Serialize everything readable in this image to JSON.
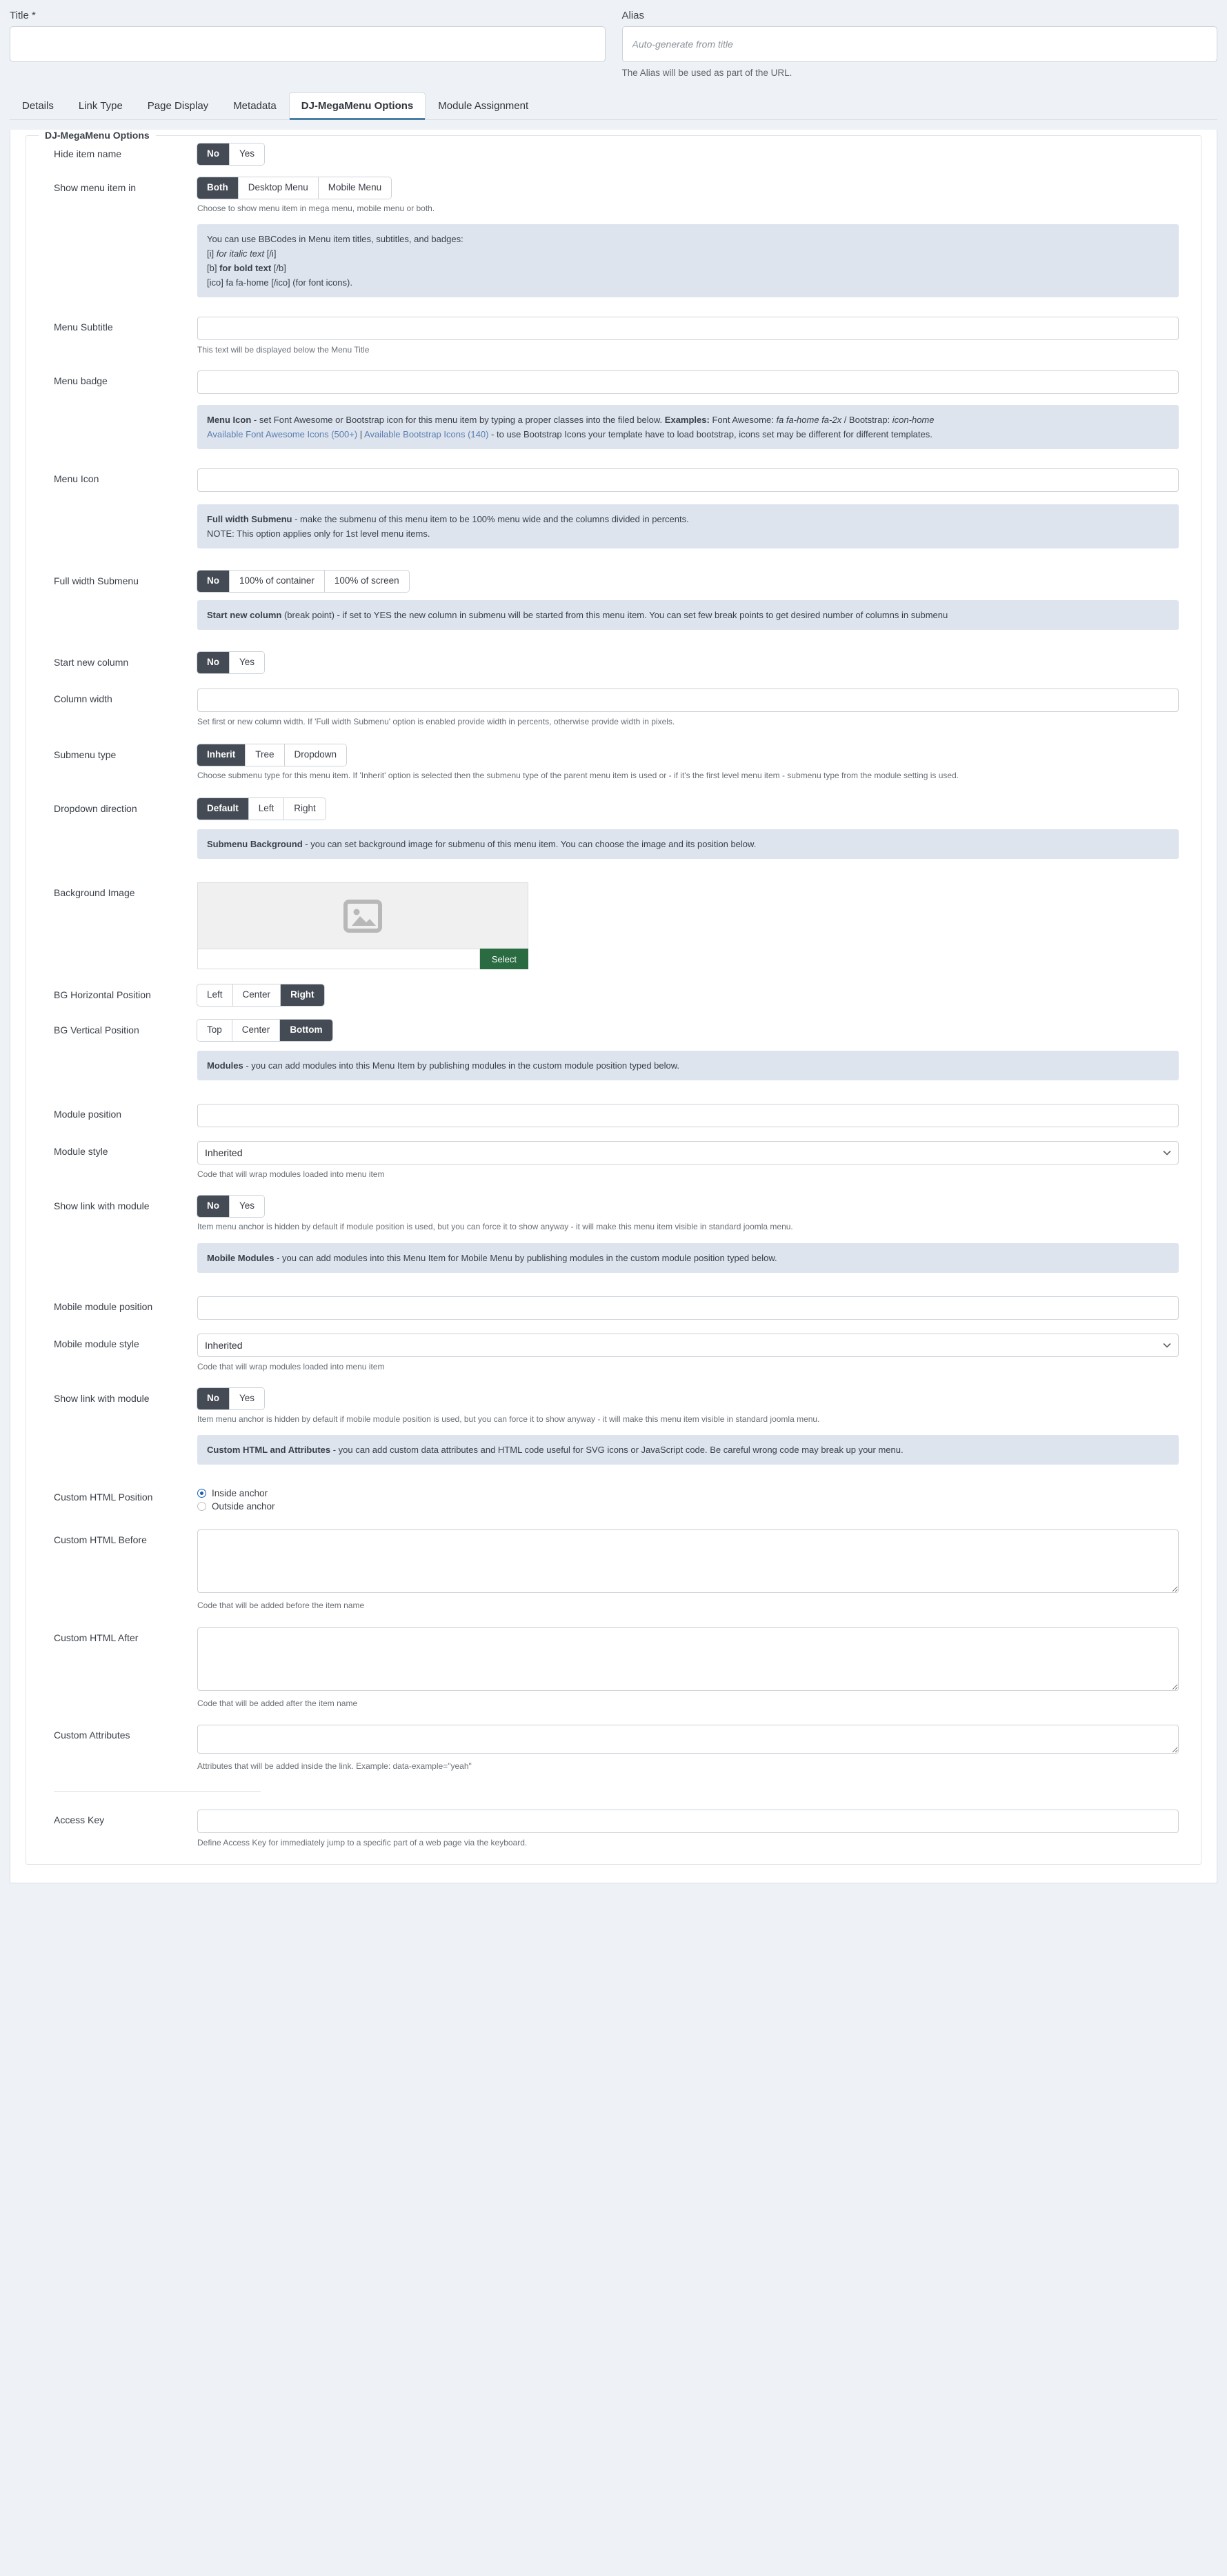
{
  "header": {
    "title_label": "Title *",
    "title_value": "",
    "alias_label": "Alias",
    "alias_placeholder": "Auto-generate from title",
    "alias_help": "The Alias will be used as part of the URL."
  },
  "tabs": [
    {
      "label": "Details",
      "active": false
    },
    {
      "label": "Link Type",
      "active": false
    },
    {
      "label": "Page Display",
      "active": false
    },
    {
      "label": "Metadata",
      "active": false
    },
    {
      "label": "DJ-MegaMenu Options",
      "active": true
    },
    {
      "label": "Module Assignment",
      "active": false
    }
  ],
  "fieldset_legend": "DJ-MegaMenu Options",
  "fields": {
    "hide_item_name": {
      "label": "Hide item name",
      "options": [
        "No",
        "Yes"
      ],
      "selected": "No"
    },
    "show_menu_item_in": {
      "label": "Show menu item in",
      "options": [
        "Both",
        "Desktop Menu",
        "Mobile Menu"
      ],
      "selected": "Both",
      "help": "Choose to show menu item in mega menu, mobile menu or both."
    },
    "bbcode_note": {
      "line1": "You can use BBCodes in Menu item titles, subtitles, and badges:",
      "line2_pre": "[i] ",
      "line2_em": "for italic text",
      "line2_post": " [/i]",
      "line3_pre": "[b] ",
      "line3_b": "for bold text",
      "line3_post": " [/b]",
      "line4": "[ico] fa fa-home [/ico] (for font icons)."
    },
    "menu_subtitle": {
      "label": "Menu Subtitle",
      "value": "",
      "help": "This text will be displayed below the Menu Title"
    },
    "menu_badge": {
      "label": "Menu badge",
      "value": ""
    },
    "menu_icon_note": {
      "bold": "Menu Icon",
      "text1": " - set Font Awesome or Bootstrap icon for this menu item by typing a proper classes into the filed below. ",
      "bold2": "Examples:",
      "text2": " Font Awesome: ",
      "em1": "fa fa-home fa-2x",
      "text3": " / Bootstrap: ",
      "em2": "icon-home",
      "link1": "Available Font Awesome Icons (500+)",
      "sep": " | ",
      "link2": "Available Bootstrap Icons (140)",
      "text4": " - to use Bootstrap Icons your template have to load bootstrap, icons set may be different for different templates."
    },
    "menu_icon": {
      "label": "Menu Icon",
      "value": ""
    },
    "full_width_note": {
      "bold": "Full width Submenu",
      "text": " - make the submenu of this menu item to be 100% menu wide and the columns divided in percents.",
      "line2": "NOTE: This option applies only for 1st level menu items."
    },
    "full_width_submenu": {
      "label": "Full width Submenu",
      "options": [
        "No",
        "100% of container",
        "100% of screen"
      ],
      "selected": "No"
    },
    "start_new_column_note": {
      "bold": "Start new column",
      "text": " (break point) - if set to YES the new column in submenu will be started from this menu item. You can set few break points to get desired number of columns in submenu"
    },
    "start_new_column": {
      "label": "Start new column",
      "options": [
        "No",
        "Yes"
      ],
      "selected": "No"
    },
    "column_width": {
      "label": "Column width",
      "value": "",
      "help": "Set first or new column width. If 'Full width Submenu' option is enabled provide width in percents, otherwise provide width in pixels."
    },
    "submenu_type": {
      "label": "Submenu type",
      "options": [
        "Inherit",
        "Tree",
        "Dropdown"
      ],
      "selected": "Inherit",
      "help": "Choose submenu type for this menu item. If 'Inherit' option is selected then the submenu type of the parent menu item is used or - if it's the first level menu item - submenu type from the module setting is used."
    },
    "dropdown_direction": {
      "label": "Dropdown direction",
      "options": [
        "Default",
        "Left",
        "Right"
      ],
      "selected": "Default"
    },
    "submenu_bg_note": {
      "bold": "Submenu Background",
      "text": " - you can set background image for submenu of this menu item. You can choose the image and its position below."
    },
    "background_image": {
      "label": "Background Image",
      "value": "",
      "select_button": "Select",
      "preview_icon": "image-placeholder-icon"
    },
    "bg_horizontal_position": {
      "label": "BG Horizontal Position",
      "options": [
        "Left",
        "Center",
        "Right"
      ],
      "selected": "Right"
    },
    "bg_vertical_position": {
      "label": "BG Vertical Position",
      "options": [
        "Top",
        "Center",
        "Bottom"
      ],
      "selected": "Bottom"
    },
    "modules_note": {
      "bold": "Modules",
      "text": " - you can add modules into this Menu Item by publishing modules in the custom module position typed below."
    },
    "module_position": {
      "label": "Module position",
      "value": ""
    },
    "module_style": {
      "label": "Module style",
      "value": "Inherited",
      "help": "Code that will wrap modules loaded into menu item"
    },
    "show_link_with_module": {
      "label": "Show link with module",
      "options": [
        "No",
        "Yes"
      ],
      "selected": "No",
      "help": "Item menu anchor is hidden by default if module position is used, but you can force it to show anyway - it will make this menu item visible in standard joomla menu."
    },
    "mobile_modules_note": {
      "bold": "Mobile Modules",
      "text": " - you can add modules into this Menu Item for Mobile Menu by publishing modules in the custom module position typed below."
    },
    "mobile_module_position": {
      "label": "Mobile module position",
      "value": ""
    },
    "mobile_module_style": {
      "label": "Mobile module style",
      "value": "Inherited",
      "help": "Code that will wrap modules loaded into menu item"
    },
    "show_link_with_module_mobile": {
      "label": "Show link with module",
      "options": [
        "No",
        "Yes"
      ],
      "selected": "No",
      "help": "Item menu anchor is hidden by default if mobile module position is used, but you can force it to show anyway - it will make this menu item visible in standard joomla menu."
    },
    "custom_html_note": {
      "bold": "Custom HTML and Attributes",
      "text": " - you can add custom data attributes and HTML code useful for SVG icons or JavaScript code. Be careful wrong code may break up your menu."
    },
    "custom_html_position": {
      "label": "Custom HTML Position",
      "options": [
        "Inside anchor",
        "Outside anchor"
      ],
      "selected": "Inside anchor"
    },
    "custom_html_before": {
      "label": "Custom HTML Before",
      "value": "",
      "help": "Code that will be added before the item name"
    },
    "custom_html_after": {
      "label": "Custom HTML After",
      "value": "",
      "help": "Code that will be added after the item name"
    },
    "custom_attributes": {
      "label": "Custom Attributes",
      "value": "",
      "help": "Attributes that will be added inside the link. Example: data-example=\"yeah\""
    },
    "access_key": {
      "label": "Access Key",
      "value": "",
      "help": "Define Access Key for immediately jump to a specific part of a web page via the keyboard."
    }
  },
  "colors": {
    "accent": "#4a7fa5",
    "selected_btn": "#454b54",
    "note_bg": "#dde4ee",
    "select_btn": "#2a6b42",
    "radio_on": "#1a5fb4"
  }
}
